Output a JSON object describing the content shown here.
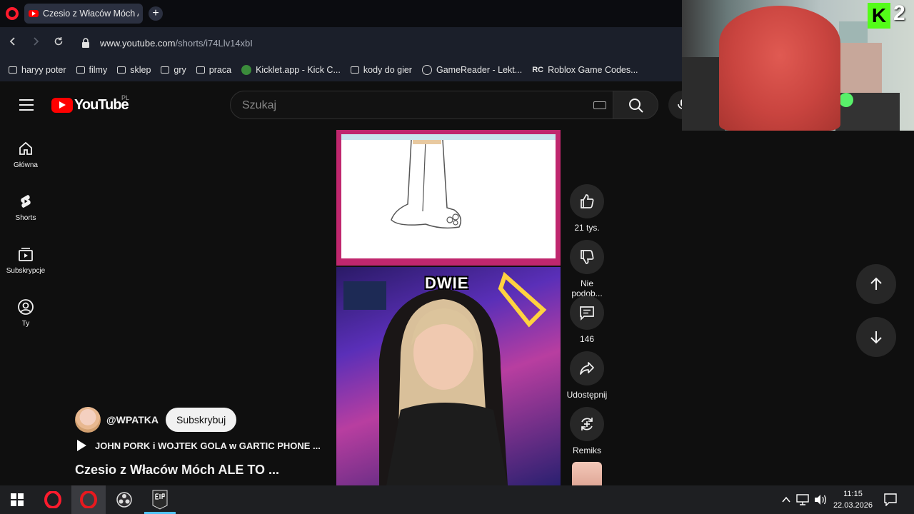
{
  "browser": {
    "tab_title": "Czesio z Właców Móch A",
    "url_host": "www.youtube.com",
    "url_path": "/shorts/i74Llv14xbI",
    "bookmarks": [
      {
        "label": "haryy poter",
        "icon": "folder-icon"
      },
      {
        "label": "filmy",
        "icon": "folder-icon"
      },
      {
        "label": "sklep",
        "icon": "folder-icon"
      },
      {
        "label": "gry",
        "icon": "folder-icon"
      },
      {
        "label": "praca",
        "icon": "folder-icon"
      },
      {
        "label": "Kicklet.app - Kick C...",
        "icon": "kicklet-icon"
      },
      {
        "label": "kody do gier",
        "icon": "folder-icon"
      },
      {
        "label": "GameReader - Lekt...",
        "icon": "gamereader-icon"
      },
      {
        "label": "Roblox Game Codes...",
        "icon": "rc-icon"
      }
    ]
  },
  "youtube": {
    "logo_text": "YouTube",
    "region": "PL",
    "search_placeholder": "Szukaj",
    "nav": [
      {
        "label": "Główna",
        "icon": "home-icon"
      },
      {
        "label": "Shorts",
        "icon": "shorts-icon"
      },
      {
        "label": "Subskrypcje",
        "icon": "subscriptions-icon"
      },
      {
        "label": "Ty",
        "icon": "you-icon"
      }
    ],
    "short": {
      "caption_word": "DWIE",
      "channel_handle": "@WPATKA",
      "subscribe_label": "Subskrybuj",
      "playlist_title": "JOHN PORK i WOJTEK GOLA w GARTIC PHONE ...",
      "video_title": "Czesio z Właców Móch ALE TO ...",
      "likes": "21 tys.",
      "dislike_label": "Nie podob...",
      "comments": "146",
      "share_label": "Udostępnij",
      "remix_label": "Remiks"
    }
  },
  "stream_overlay": {
    "kick_letter": "K",
    "viewer_count": "2"
  },
  "taskbar": {
    "time": "11:15",
    "date": "22.03.2026"
  },
  "colors": {
    "youtube_red": "#ff0000",
    "opera_red": "#ff1b2d",
    "kick_green": "#53fc18"
  }
}
